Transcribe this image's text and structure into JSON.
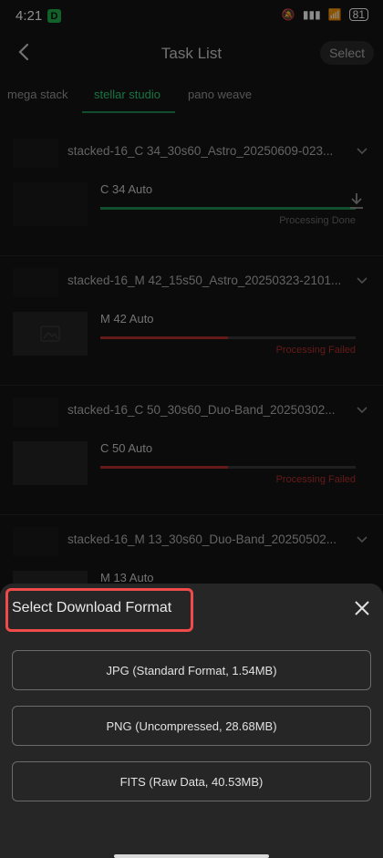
{
  "status": {
    "time": "4:21",
    "app_badge": "D",
    "battery": "81"
  },
  "header": {
    "title": "Task List",
    "select": "Select"
  },
  "tabs": [
    {
      "label": "mega stack",
      "active": false
    },
    {
      "label": "stellar studio",
      "active": true
    },
    {
      "label": "pano weave",
      "active": false
    }
  ],
  "tasks": [
    {
      "name": "stacked-16_C 34_30s60_Astro_20250609-023...",
      "label": "C 34 Auto",
      "status": "Processing Done",
      "progress": 1.0,
      "color": "#1e8e55",
      "status_color": "#6f6f6f"
    },
    {
      "name": "stacked-16_M 42_15s50_Astro_20250323-2101...",
      "label": "M 42 Auto",
      "status": "Processing Failed",
      "progress": 0.5,
      "color": "#b7302f",
      "status_color": "#b7302f"
    },
    {
      "name": "stacked-16_C 50_30s60_Duo-Band_20250302...",
      "label": "C 50 Auto",
      "status": "Processing Failed",
      "progress": 0.5,
      "color": "#b7302f",
      "status_color": "#b7302f"
    },
    {
      "name": "stacked-16_M 13_30s60_Duo-Band_20250502...",
      "label": "M 13 Auto",
      "status": "",
      "progress": 0.0,
      "color": "#1e8e55",
      "status_color": "#6f6f6f"
    }
  ],
  "sheet": {
    "title": "Select Download Format",
    "options": [
      "JPG (Standard Format, 1.54MB)",
      "PNG (Uncompressed, 28.68MB)",
      "FITS (Raw Data, 40.53MB)"
    ]
  }
}
